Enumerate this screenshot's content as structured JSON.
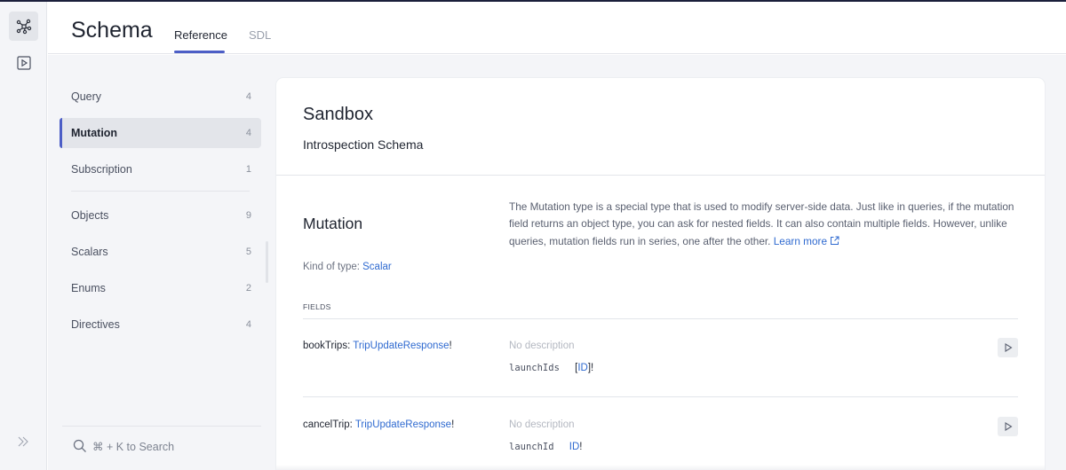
{
  "header": {
    "title": "Schema",
    "tabs": [
      {
        "label": "Reference",
        "active": true
      },
      {
        "label": "SDL",
        "active": false
      }
    ]
  },
  "rail": {
    "items": [
      {
        "icon": "schema-graph-icon",
        "active": true
      },
      {
        "icon": "play-square-icon",
        "active": false
      }
    ],
    "expand_icon": "double-chevron-right-icon"
  },
  "nav": {
    "root_types": [
      {
        "label": "Query",
        "count": "4",
        "active": false
      },
      {
        "label": "Mutation",
        "count": "4",
        "active": true
      },
      {
        "label": "Subscription",
        "count": "1",
        "active": false
      }
    ],
    "categories": [
      {
        "label": "Objects",
        "count": "9"
      },
      {
        "label": "Scalars",
        "count": "5"
      },
      {
        "label": "Enums",
        "count": "2"
      },
      {
        "label": "Directives",
        "count": "4"
      }
    ],
    "search_label": "⌘ + K to Search"
  },
  "card": {
    "title": "Sandbox",
    "subtitle": "Introspection Schema",
    "type_name": "Mutation",
    "kind_label": "Kind of type: ",
    "kind_value": "Scalar",
    "description": "The Mutation type is a special type that is used to modify server-side data. Just like in queries, if the mutation field returns an object type, you can ask for nested fields. It can also contain multiple fields. However, unlike queries, mutation fields run in series, one after the other. ",
    "learn_more": "Learn more",
    "fields_label": "FIELDS",
    "fields": [
      {
        "name": "bookTrips",
        "return_type": "TripUpdateResponse",
        "suffix": "!",
        "description": "No description",
        "arg_name": "launchIds",
        "arg_prefix": "[",
        "arg_type": "ID",
        "arg_suffix": "]!"
      },
      {
        "name": "cancelTrip",
        "return_type": "TripUpdateResponse",
        "suffix": "!",
        "description": "No description",
        "arg_name": "launchId",
        "arg_prefix": "",
        "arg_type": "ID",
        "arg_suffix": "!"
      }
    ]
  },
  "colors": {
    "accent": "#4c5ec6",
    "link": "#2f6ad0"
  }
}
